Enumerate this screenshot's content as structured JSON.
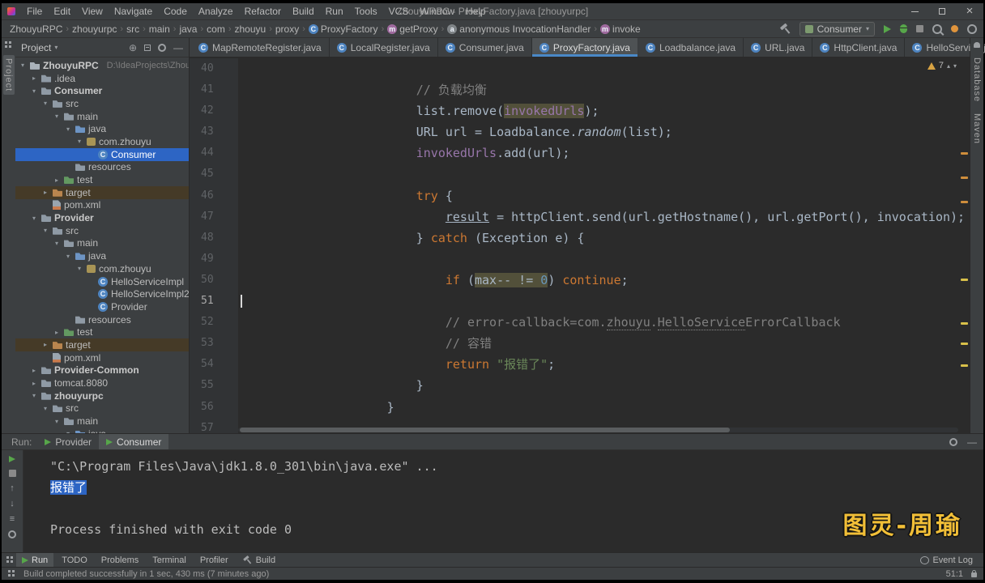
{
  "title_bar": {
    "menus": [
      "File",
      "Edit",
      "View",
      "Navigate",
      "Code",
      "Analyze",
      "Refactor",
      "Build",
      "Run",
      "Tools",
      "VCS",
      "Window",
      "Help"
    ],
    "title": "ZhouyuRPC - ProxyFactory.java [zhouyurpc]"
  },
  "navbar": {
    "crumbs": [
      {
        "label": "ZhouyuRPC"
      },
      {
        "label": "zhouyurpc"
      },
      {
        "label": "src"
      },
      {
        "label": "main"
      },
      {
        "label": "java"
      },
      {
        "label": "com"
      },
      {
        "label": "zhouyu"
      },
      {
        "label": "proxy"
      },
      {
        "label": "ProxyFactory",
        "icon": "class"
      },
      {
        "label": "getProxy",
        "icon": "method"
      },
      {
        "label": "anonymous InvocationHandler",
        "icon": "class-anon"
      },
      {
        "label": "invoke",
        "icon": "method"
      }
    ],
    "run_config": "Consumer"
  },
  "project_panel": {
    "header": "Project",
    "tree": [
      {
        "label": "ZhouyuRPC",
        "hint": "D:\\IdeaProjects\\Zhouyu",
        "indent": 0,
        "arrow": "v",
        "icon": "project",
        "bold": true
      },
      {
        "label": ".idea",
        "indent": 1,
        "arrow": ">",
        "icon": "folder"
      },
      {
        "label": "Consumer",
        "indent": 1,
        "arrow": "v",
        "icon": "folder",
        "bold": true
      },
      {
        "label": "src",
        "indent": 2,
        "arrow": "v",
        "icon": "folder"
      },
      {
        "label": "main",
        "indent": 3,
        "arrow": "v",
        "icon": "folder"
      },
      {
        "label": "java",
        "indent": 4,
        "arrow": "v",
        "icon": "folder-src"
      },
      {
        "label": "com.zhouyu",
        "indent": 5,
        "arrow": "v",
        "icon": "package"
      },
      {
        "label": "Consumer",
        "indent": 6,
        "icon": "class",
        "selected": true
      },
      {
        "label": "resources",
        "indent": 4,
        "icon": "folder-res"
      },
      {
        "label": "test",
        "indent": 3,
        "arrow": ">",
        "icon": "folder-test"
      },
      {
        "label": "target",
        "indent": 2,
        "arrow": ">",
        "icon": "folder-excluded",
        "excluded": true
      },
      {
        "label": "pom.xml",
        "indent": 2,
        "icon": "file-maven"
      },
      {
        "label": "Provider",
        "indent": 1,
        "arrow": "v",
        "icon": "folder",
        "bold": true
      },
      {
        "label": "src",
        "indent": 2,
        "arrow": "v",
        "icon": "folder"
      },
      {
        "label": "main",
        "indent": 3,
        "arrow": "v",
        "icon": "folder"
      },
      {
        "label": "java",
        "indent": 4,
        "arrow": "v",
        "icon": "folder-src"
      },
      {
        "label": "com.zhouyu",
        "indent": 5,
        "arrow": "v",
        "icon": "package"
      },
      {
        "label": "HelloServiceImpl",
        "indent": 6,
        "icon": "class"
      },
      {
        "label": "HelloServiceImpl2",
        "indent": 6,
        "icon": "class"
      },
      {
        "label": "Provider",
        "indent": 6,
        "icon": "class"
      },
      {
        "label": "resources",
        "indent": 4,
        "icon": "folder-res"
      },
      {
        "label": "test",
        "indent": 3,
        "arrow": ">",
        "icon": "folder-test"
      },
      {
        "label": "target",
        "indent": 2,
        "arrow": ">",
        "icon": "folder-excluded",
        "excluded": true
      },
      {
        "label": "pom.xml",
        "indent": 2,
        "icon": "file-maven"
      },
      {
        "label": "Provider-Common",
        "indent": 1,
        "arrow": ">",
        "icon": "folder",
        "bold": true
      },
      {
        "label": "tomcat.8080",
        "indent": 1,
        "arrow": ">",
        "icon": "folder"
      },
      {
        "label": "zhouyurpc",
        "indent": 1,
        "arrow": "v",
        "icon": "folder",
        "bold": true
      },
      {
        "label": "src",
        "indent": 2,
        "arrow": "v",
        "icon": "folder"
      },
      {
        "label": "main",
        "indent": 3,
        "arrow": "v",
        "icon": "folder"
      },
      {
        "label": "java",
        "indent": 4,
        "arrow": "v",
        "icon": "folder-src"
      }
    ]
  },
  "editor": {
    "tabs": [
      {
        "label": "MapRemoteRegister.java"
      },
      {
        "label": "LocalRegister.java"
      },
      {
        "label": "Consumer.java"
      },
      {
        "label": "ProxyFactory.java",
        "active": true
      },
      {
        "label": "Loadbalance.java"
      },
      {
        "label": "URL.java"
      },
      {
        "label": "HttpClient.java"
      },
      {
        "label": "HelloService.java"
      }
    ],
    "inspections_count": "7",
    "lines": [
      {
        "num": "40",
        "segs": []
      },
      {
        "num": "41",
        "segs": [
          {
            "t": "                        ",
            "s": "pl"
          },
          {
            "t": "// 负载均衡",
            "s": "cm"
          }
        ]
      },
      {
        "num": "42",
        "segs": [
          {
            "t": "                        ",
            "s": "pl"
          },
          {
            "t": "list.remove(",
            "s": "pl"
          },
          {
            "t": "invokedUrls",
            "s": "fd hl"
          },
          {
            "t": ");",
            "s": "pl"
          }
        ]
      },
      {
        "num": "43",
        "segs": [
          {
            "t": "                        ",
            "s": "pl"
          },
          {
            "t": "URL url = Loadbalance.",
            "s": "pl"
          },
          {
            "t": "random",
            "s": "pl it"
          },
          {
            "t": "(list);",
            "s": "pl"
          }
        ]
      },
      {
        "num": "44",
        "segs": [
          {
            "t": "                        ",
            "s": "pl"
          },
          {
            "t": "invokedUrls",
            "s": "fd"
          },
          {
            "t": ".add(url);",
            "s": "pl"
          }
        ]
      },
      {
        "num": "45",
        "segs": []
      },
      {
        "num": "46",
        "segs": [
          {
            "t": "                        ",
            "s": "pl"
          },
          {
            "t": "try",
            "s": "kw"
          },
          {
            "t": " {",
            "s": "pl"
          }
        ]
      },
      {
        "num": "47",
        "segs": [
          {
            "t": "                            ",
            "s": "pl"
          },
          {
            "t": "result",
            "s": "pl un"
          },
          {
            "t": " = httpClient.send(url.getHostname(), url.getPort(), invocation);",
            "s": "pl"
          }
        ]
      },
      {
        "num": "48",
        "segs": [
          {
            "t": "                        ",
            "s": "pl"
          },
          {
            "t": "} ",
            "s": "pl"
          },
          {
            "t": "catch",
            "s": "kw"
          },
          {
            "t": " (Exception e) {",
            "s": "pl"
          }
        ]
      },
      {
        "num": "49",
        "segs": []
      },
      {
        "num": "50",
        "segs": [
          {
            "t": "                            ",
            "s": "pl"
          },
          {
            "t": "if",
            "s": "kw"
          },
          {
            "t": " (",
            "s": "pl"
          },
          {
            "t": "max-- != ",
            "s": "pl hl"
          },
          {
            "t": "0",
            "s": "nm hl"
          },
          {
            "t": ") ",
            "s": "pl"
          },
          {
            "t": "continue",
            "s": "kw"
          },
          {
            "t": ";",
            "s": "pl"
          }
        ]
      },
      {
        "num": "51",
        "caret": true,
        "segs": []
      },
      {
        "num": "52",
        "segs": [
          {
            "t": "                            ",
            "s": "pl"
          },
          {
            "t": "// error-callback=com.",
            "s": "cm"
          },
          {
            "t": "zhouyu",
            "s": "cm du"
          },
          {
            "t": ".",
            "s": "cm"
          },
          {
            "t": "HelloService",
            "s": "cm du"
          },
          {
            "t": "ErrorCallback",
            "s": "cm"
          }
        ]
      },
      {
        "num": "53",
        "segs": [
          {
            "t": "                            ",
            "s": "pl"
          },
          {
            "t": "// 容错",
            "s": "cm"
          }
        ]
      },
      {
        "num": "54",
        "segs": [
          {
            "t": "                            ",
            "s": "pl"
          },
          {
            "t": "return",
            "s": "kw"
          },
          {
            "t": " ",
            "s": "pl"
          },
          {
            "t": "\"报错了\"",
            "s": "st"
          },
          {
            "t": ";",
            "s": "pl"
          }
        ]
      },
      {
        "num": "55",
        "segs": [
          {
            "t": "                        ",
            "s": "pl"
          },
          {
            "t": "}",
            "s": "pl"
          }
        ]
      },
      {
        "num": "56",
        "segs": [
          {
            "t": "                    ",
            "s": "pl"
          },
          {
            "t": "}",
            "s": "pl"
          }
        ]
      },
      {
        "num": "57",
        "segs": []
      }
    ]
  },
  "run_panel": {
    "label": "Run:",
    "tabs": [
      {
        "label": "Provider"
      },
      {
        "label": "Consumer",
        "active": true
      }
    ],
    "console": [
      {
        "t": "\"C:\\Program Files\\Java\\jdk1.8.0_301\\bin\\java.exe\" ..."
      },
      {
        "t": "报错了",
        "selected": true
      },
      {
        "t": ""
      },
      {
        "t": "Process finished with exit code 0"
      }
    ]
  },
  "bottom_bar": {
    "left": [
      {
        "label": "Run",
        "icon": "run",
        "active": true
      },
      {
        "label": "TODO"
      },
      {
        "label": "Problems"
      },
      {
        "label": "Terminal"
      },
      {
        "label": "Profiler"
      },
      {
        "label": "Build",
        "icon": "hammer"
      }
    ],
    "right": [
      {
        "label": "Event Log",
        "icon": "bubble"
      }
    ]
  },
  "status_bar": {
    "message": "Build completed successfully in 1 sec, 430 ms (7 minutes ago)",
    "caret": "51:1"
  },
  "left_stripe": [
    "Project"
  ],
  "right_stripe": [
    "Database",
    "Maven"
  ],
  "watermark": "图灵-周瑜",
  "colors": {
    "panel_bg": "#3c3f41",
    "editor_bg": "#2b2b2b",
    "selection_blue": "#2d65c4",
    "occurrence_highlight": "#52503a",
    "excluded_row": "#453a27",
    "keyword": "#cc7832",
    "string": "#6a8759",
    "comment": "#808080",
    "field": "#9876aa",
    "number": "#6897bb",
    "active_tab_underline": "#4a88c7",
    "run_green": "#57a64a",
    "warning_yellow": "#d8a343",
    "watermark_yellow": "#f2bf37"
  }
}
